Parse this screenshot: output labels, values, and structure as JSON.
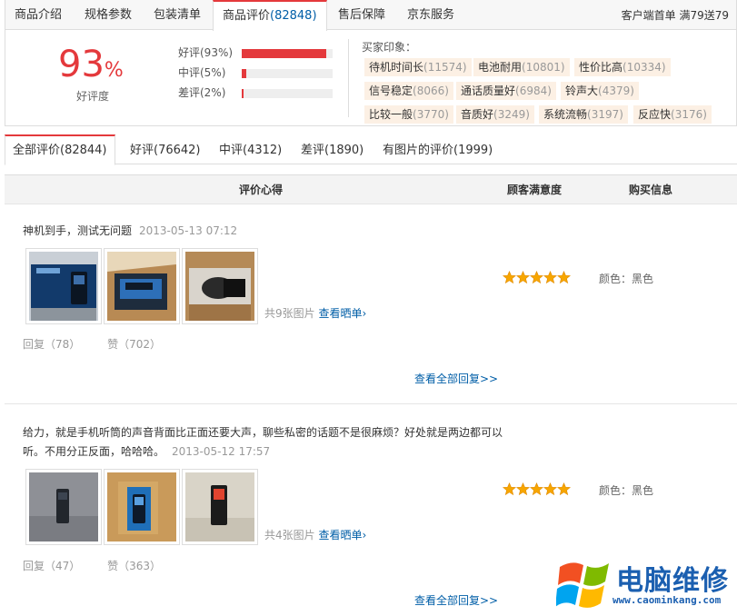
{
  "top_tabs": [
    {
      "label": "商品介绍"
    },
    {
      "label": "规格参数"
    },
    {
      "label": "包装清单"
    },
    {
      "label": "商品评价",
      "count": "(82848)"
    },
    {
      "label": "售后保障"
    },
    {
      "label": "京东服务"
    }
  ],
  "promo": "客户端首单 满79送79",
  "summary": {
    "rate": "93",
    "rate_unit": "%",
    "rate_label": "好评度",
    "bars": [
      {
        "label": "好评(93%)",
        "value": 0.93
      },
      {
        "label": "中评(5%)",
        "value": 0.05
      },
      {
        "label": "差评(2%)",
        "value": 0.02
      }
    ],
    "impressions_title": "买家印象：",
    "tags": [
      {
        "text": "待机时间长",
        "count": "(11574)"
      },
      {
        "text": "电池耐用",
        "count": "(10801)"
      },
      {
        "text": "性价比高",
        "count": "(10334)"
      },
      {
        "text": "信号稳定",
        "count": "(8066)"
      },
      {
        "text": "通话质量好",
        "count": "(6984)"
      },
      {
        "text": "铃声大",
        "count": "(4379)"
      },
      {
        "text": "比较一般",
        "count": "(3770)"
      },
      {
        "text": "音质好",
        "count": "(3249)"
      },
      {
        "text": "系统流畅",
        "count": "(3197)"
      },
      {
        "text": "反应快",
        "count": "(3176)"
      }
    ]
  },
  "filter_tabs": [
    {
      "label": "全部评价(82844)"
    },
    {
      "label": "好评(76642)"
    },
    {
      "label": "中评(4312)"
    },
    {
      "label": "差评(1890)"
    },
    {
      "label": "有图片的评价(1999)"
    }
  ],
  "columns": {
    "content": "评价心得",
    "satisfaction": "顾客满意度",
    "purchase": "购买信息"
  },
  "reviews": [
    {
      "text_line1": "神机到手，测试无问题",
      "text_line2": "",
      "time": "2013-05-13 07:12",
      "pic_count": "共9张图片",
      "view_link": "查看晒单",
      "stars": 5,
      "color": "颜色：黑色",
      "reply_label": "回复（78）",
      "like_label": "赞（702）",
      "see_all": "查看全部回复>>"
    },
    {
      "text_line1": "给力，就是手机听筒的声音背面比正面还要大声，聊些私密的话题不是很麻烦？好处就是两边都可以",
      "text_line2": "听。不用分正反面，哈哈哈。",
      "time": "2013-05-12 17:57",
      "pic_count": "共4张图片",
      "view_link": "查看晒单",
      "stars": 5,
      "color": "颜色：黑色",
      "reply_label": "回复（47）",
      "like_label": "赞（363）",
      "see_all": "查看全部回复>>"
    }
  ],
  "watermark": {
    "title": "电脑维修",
    "url": "www.caominkang.com"
  }
}
